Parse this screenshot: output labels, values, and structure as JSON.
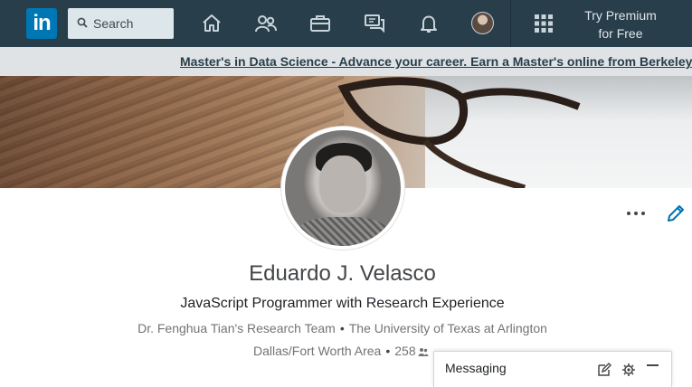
{
  "topnav": {
    "logo_text": "in",
    "search": {
      "placeholder": "Search"
    },
    "icons": [
      "home-icon",
      "my-network-icon",
      "jobs-icon",
      "messaging-icon",
      "notifications-icon",
      "me-avatar",
      "work-grid-icon"
    ],
    "premium_line1": "Try Premium",
    "premium_line2": "for Free"
  },
  "ad": {
    "text": "Master's in Data Science - Advance your career. Earn a Master's online from Berkeley in D"
  },
  "profile": {
    "name": "Eduardo J. Velasco",
    "headline": "JavaScript Programmer with Research Experience",
    "company": "Dr. Fenghua Tian's Research Team",
    "school": "The University of Texas at Arlington",
    "separator": "•",
    "location": "Dallas/Fort Worth Area",
    "connections": "258"
  },
  "messaging": {
    "title": "Messaging"
  },
  "colors": {
    "nav_bg": "#283e4a",
    "brand_blue": "#0077b5",
    "edit_blue": "#0073b1"
  }
}
